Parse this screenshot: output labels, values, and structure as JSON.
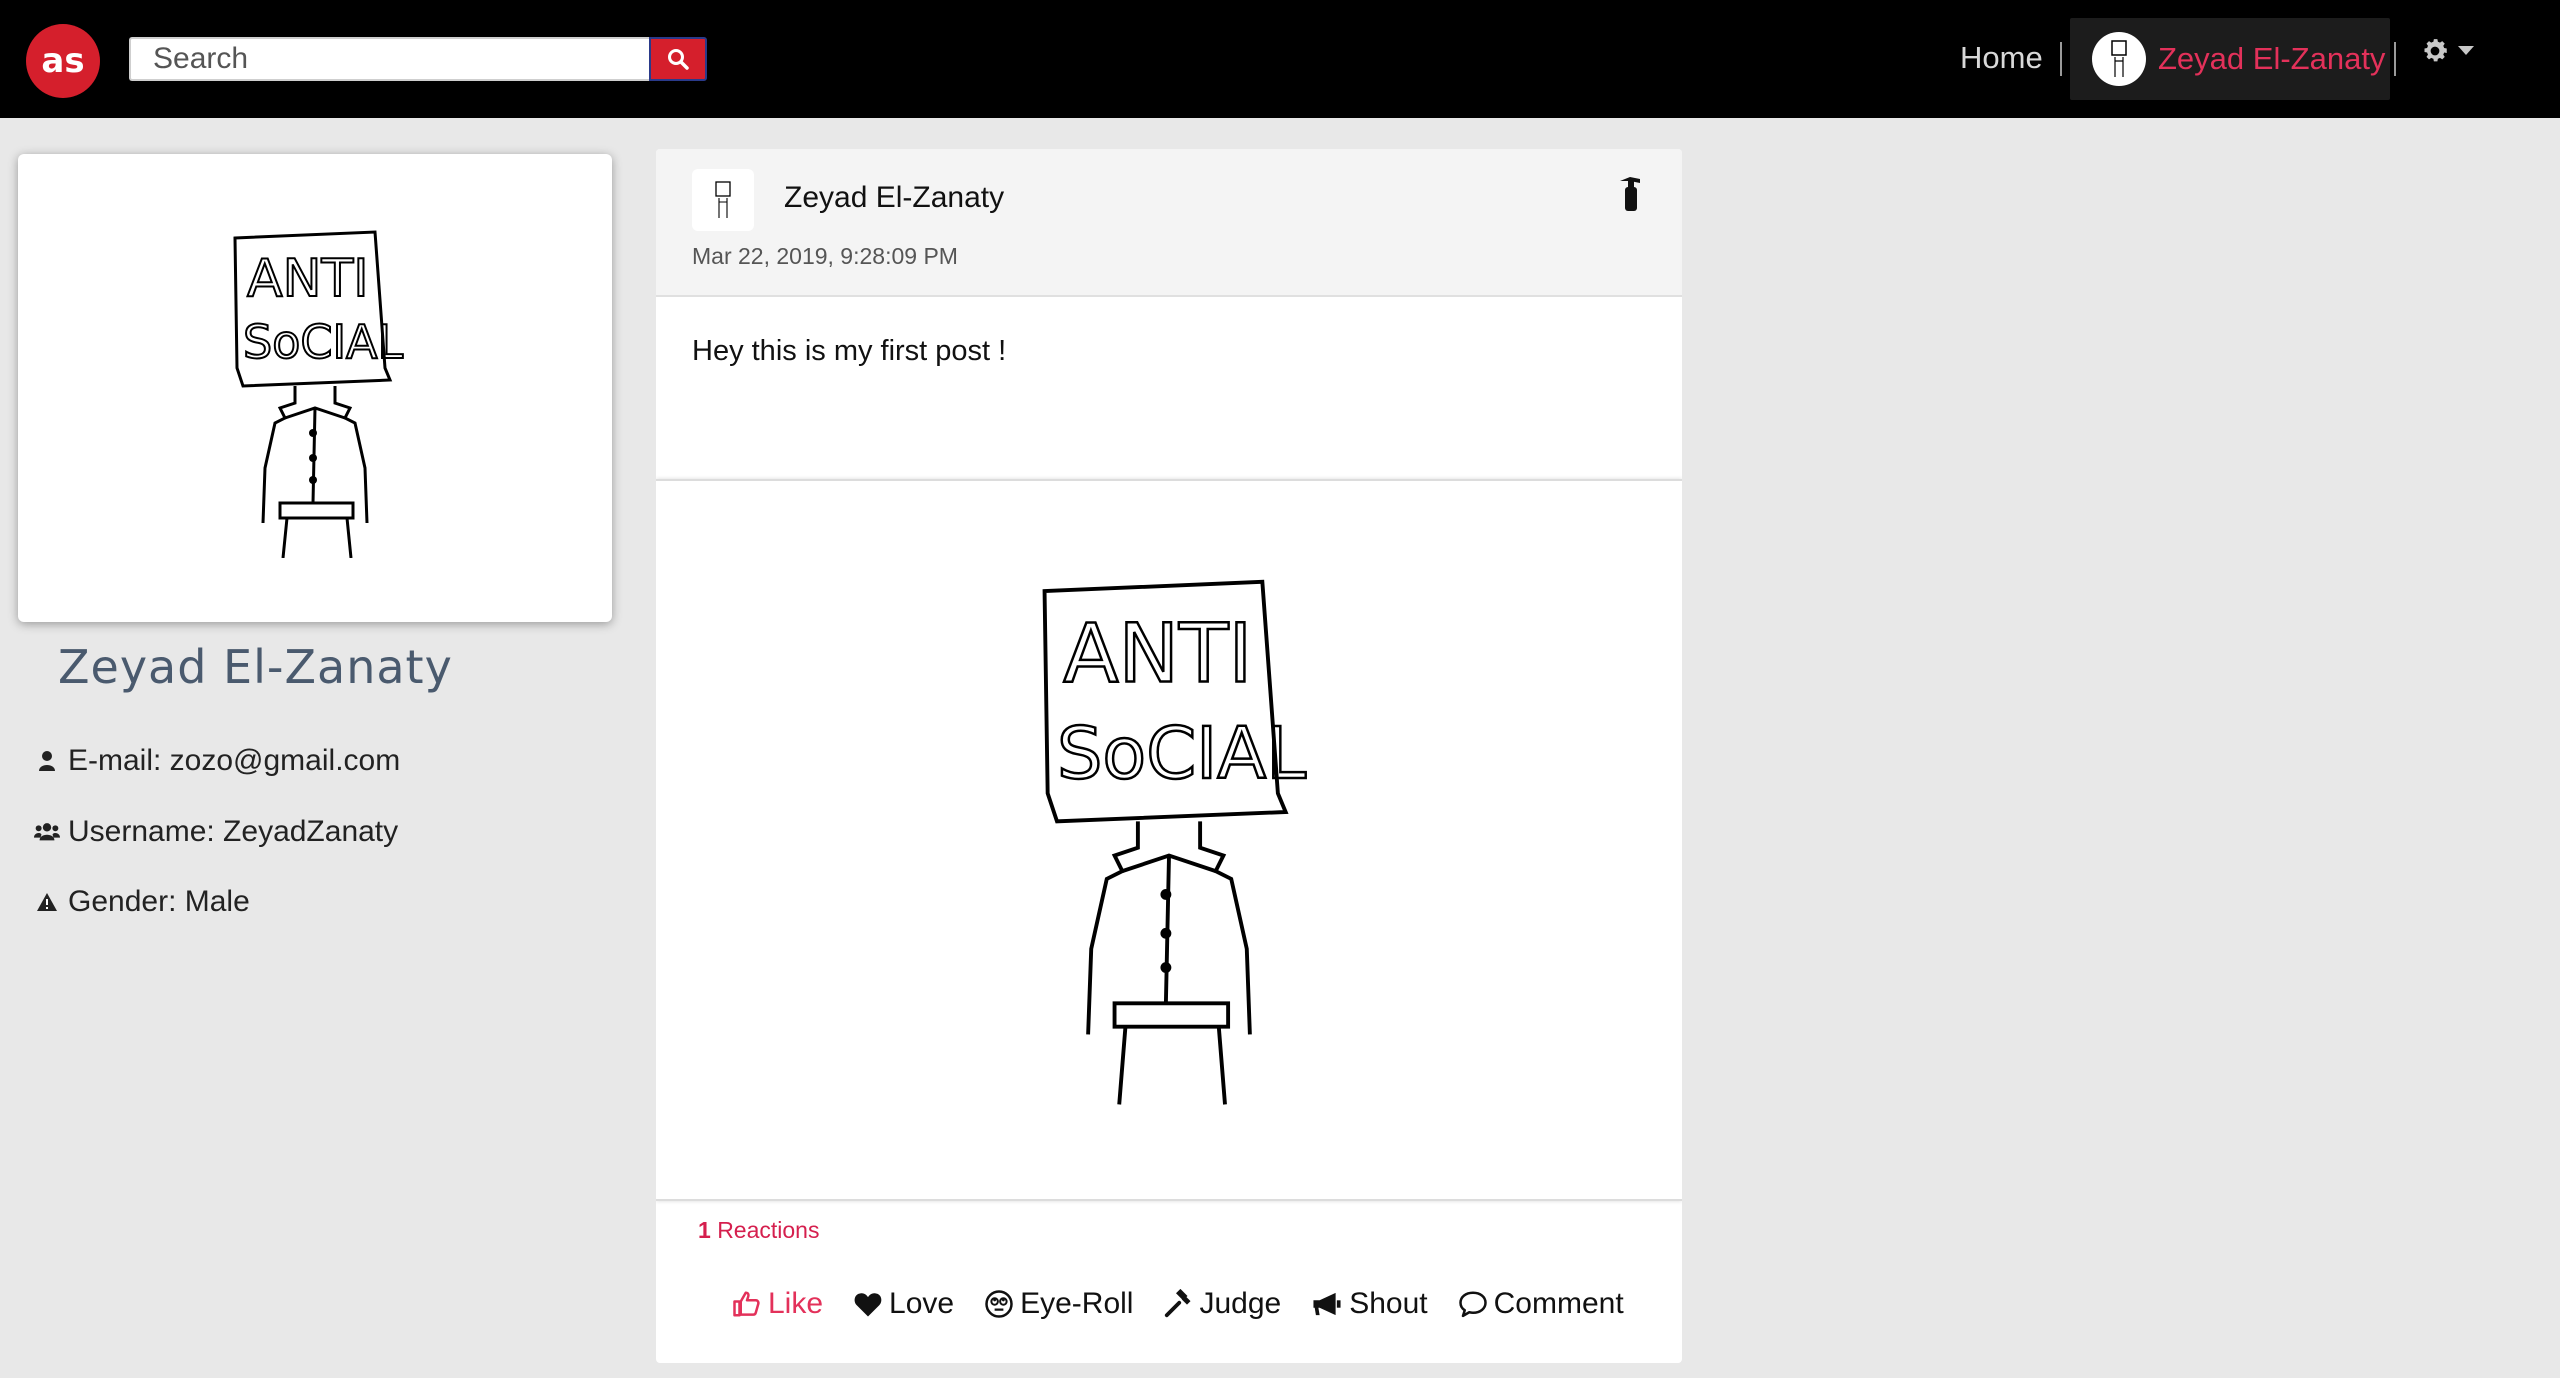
{
  "navbar": {
    "search_placeholder": "Search",
    "home_label": "Home",
    "profile_name": "Zeyad El-Zanaty",
    "accent_color": "#d51f2c"
  },
  "profile": {
    "name": "Zeyad El-Zanaty",
    "email_row": "E-mail: zozo@gmail.com",
    "username_row": "Username: ZeyadZanaty",
    "gender_row": "Gender: Male",
    "image_text_line1": "ANTI",
    "image_text_line2": "SoCIAL"
  },
  "post": {
    "author": "Zeyad El-Zanaty",
    "date": "Mar 22, 2019, 9:28:09 PM",
    "text": "Hey this is my first post !",
    "image_text_line1": "ANTI",
    "image_text_line2": "SoCIAL",
    "reactions_count": "1",
    "reactions_label": "Reactions",
    "actions": {
      "like": "Like",
      "love": "Love",
      "eyeroll": "Eye-Roll",
      "judge": "Judge",
      "shout": "Shout",
      "comment": "Comment"
    },
    "active_reaction": "like"
  }
}
